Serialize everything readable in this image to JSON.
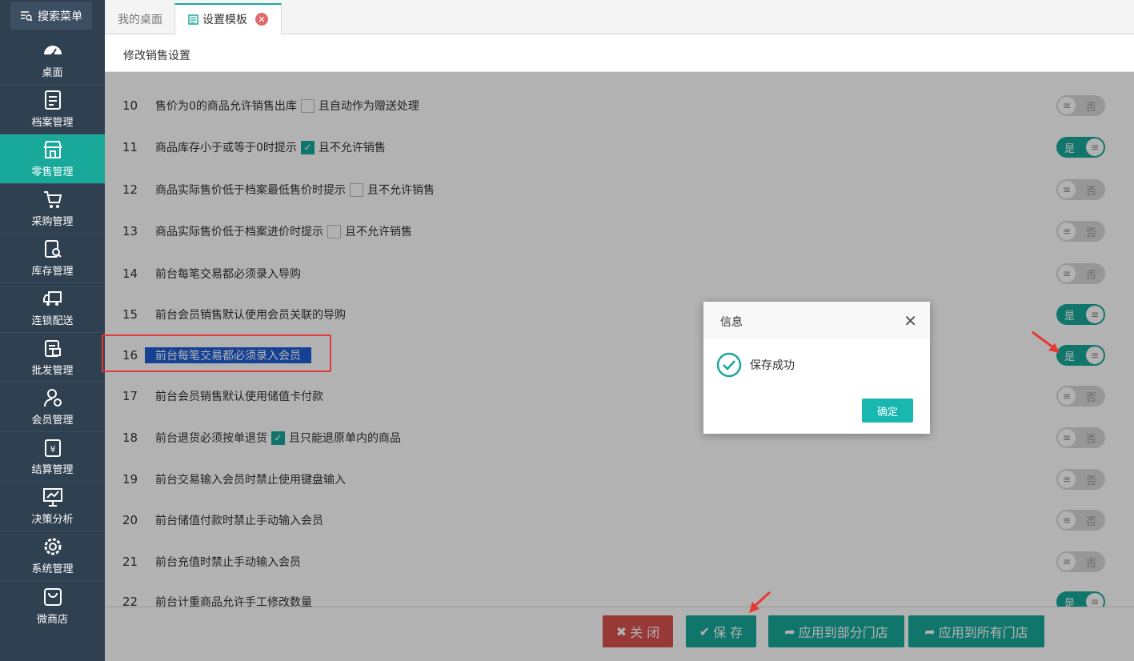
{
  "sidebar": {
    "search_label": "搜索菜单",
    "items": [
      {
        "label": "桌面",
        "icon": "dashboard-icon"
      },
      {
        "label": "档案管理",
        "icon": "archive-icon"
      },
      {
        "label": "零售管理",
        "icon": "store-icon"
      },
      {
        "label": "采购管理",
        "icon": "cart-icon"
      },
      {
        "label": "库存管理",
        "icon": "inventory-icon"
      },
      {
        "label": "连锁配送",
        "icon": "truck-icon"
      },
      {
        "label": "批发管理",
        "icon": "wholesale-icon"
      },
      {
        "label": "会员管理",
        "icon": "member-icon"
      },
      {
        "label": "结算管理",
        "icon": "yen-icon"
      },
      {
        "label": "决策分析",
        "icon": "chart-icon"
      },
      {
        "label": "系统管理",
        "icon": "gear-icon"
      },
      {
        "label": "微商店",
        "icon": "bag-icon"
      }
    ],
    "active": "零售管理"
  },
  "tabs": [
    {
      "label": "我的桌面"
    },
    {
      "label": "设置模板"
    }
  ],
  "page": {
    "title": "修改销售设置"
  },
  "settings": [
    {
      "num": "10",
      "text": "售价为0的商品允许销售出库",
      "checkbox": false,
      "suffix": "且自动作为赠送处理",
      "state": "否"
    },
    {
      "num": "11",
      "text": "商品库存小于或等于0时提示",
      "checkbox": true,
      "suffix": "且不允许销售",
      "state": "是"
    },
    {
      "num": "12",
      "text": "商品实际售价低于档案最低售价时提示",
      "checkbox": false,
      "suffix": "且不允许销售",
      "state": "否"
    },
    {
      "num": "13",
      "text": "商品实际售价低于档案进价时提示",
      "checkbox": false,
      "suffix": "且不允许销售",
      "state": "否"
    },
    {
      "num": "14",
      "text": "前台每笔交易都必须录入导购",
      "state": "否"
    },
    {
      "num": "15",
      "text": "前台会员销售默认使用会员关联的导购",
      "state": "是"
    },
    {
      "num": "16",
      "text": "前台每笔交易都必须录入会员",
      "state": "是",
      "highlight": true
    },
    {
      "num": "17",
      "text": "前台会员销售默认使用储值卡付款",
      "state": "否"
    },
    {
      "num": "18",
      "text": "前台退货必须按单退货",
      "checkbox": true,
      "suffix": "且只能退原单内的商品",
      "state": "否"
    },
    {
      "num": "19",
      "text": "前台交易输入会员时禁止使用键盘输入",
      "state": "否"
    },
    {
      "num": "20",
      "text": "前台储值付款时禁止手动输入会员",
      "state": "否"
    },
    {
      "num": "21",
      "text": "前台充值时禁止手动输入会员",
      "state": "否"
    },
    {
      "num": "22",
      "text": "前台计重商品允许手工修改数量",
      "state": "是"
    }
  ],
  "footer": {
    "close": "关 闭",
    "save": "保 存",
    "apply_some": "应用到部分门店",
    "apply_all": "应用到所有门店"
  },
  "dialog": {
    "title": "信息",
    "message": "保存成功",
    "ok": "确定"
  },
  "colors": {
    "accent": "#18a99a",
    "sidebar": "#2f4050",
    "danger": "#d9534f"
  }
}
